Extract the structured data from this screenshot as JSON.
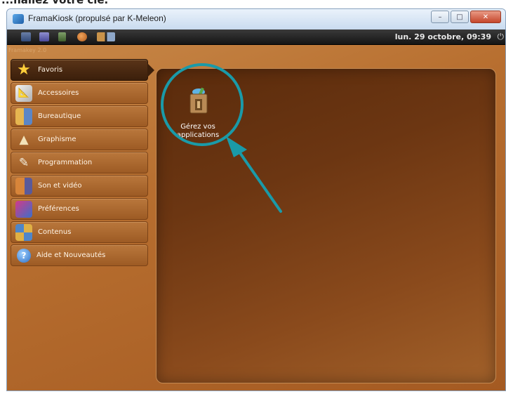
{
  "cropped_caption": "...nallez votre clé.",
  "window": {
    "title": "FramaKiosk (propulsé par K-Meleon)",
    "controls": [
      "–",
      "□",
      "✕"
    ]
  },
  "topbar": {
    "datetime": "lun. 29 octobre, 09:39",
    "launcher_icons": [
      "window-icon",
      "monitor-icon",
      "trash-icon",
      "globe-icon",
      "folders-icon"
    ]
  },
  "version": "Framakey 2.0",
  "menu": {
    "items": [
      {
        "label": "Favoris",
        "icon": "star-icon",
        "active": true
      },
      {
        "label": "Accessoires",
        "icon": "ruler-icon",
        "active": false
      },
      {
        "label": "Bureautique",
        "icon": "office-icon",
        "active": false
      },
      {
        "label": "Graphisme",
        "icon": "paint-icon",
        "active": false
      },
      {
        "label": "Programmation",
        "icon": "brush-icon",
        "active": false
      },
      {
        "label": "Son et vidéo",
        "icon": "media-icon",
        "active": false
      },
      {
        "label": "Préférences",
        "icon": "preferences-icon",
        "active": false
      },
      {
        "label": "Contenus",
        "icon": "grid-icon",
        "active": false
      },
      {
        "label": "Aide et Nouveautés",
        "icon": "help-icon",
        "active": false
      }
    ]
  },
  "favorites": {
    "apps": [
      {
        "label_line1": "Gérez vos",
        "label_line2": "applications",
        "icon": "app-manager-icon"
      }
    ]
  },
  "colors": {
    "accent_annotation": "#1a9aa8",
    "panel_bg": "#6c3612",
    "sidebar_bg": "#b9773c"
  }
}
